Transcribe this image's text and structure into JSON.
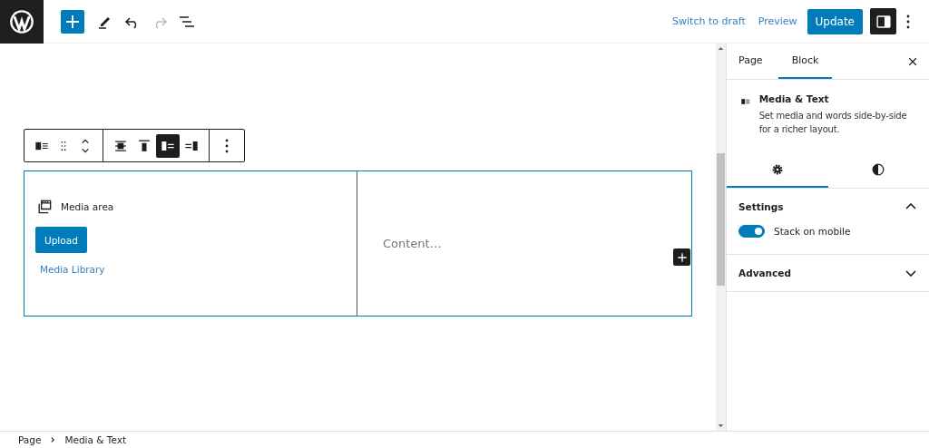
{
  "top_bar": {
    "tools": [
      {
        "kind": "inserter",
        "disabled": false
      },
      {
        "kind": "tools",
        "disabled": false
      },
      {
        "kind": "undo",
        "disabled": false
      },
      {
        "kind": "redo",
        "disabled": true
      },
      {
        "kind": "outline",
        "disabled": false
      }
    ],
    "links": [
      "Switch to draft",
      "Preview"
    ],
    "primary_button": "Update",
    "settings_toggle": {
      "selected": true
    }
  },
  "block_toolbar": {
    "block_tools": [
      {
        "kind": "block-type"
      },
      {
        "kind": "drag"
      },
      {
        "kind": "mover"
      }
    ],
    "alignment": [
      {
        "kind": "align-center",
        "selected": false
      },
      {
        "kind": "align-top",
        "selected": false
      },
      {
        "kind": "media-left",
        "selected": true
      },
      {
        "kind": "media-right",
        "selected": false
      }
    ]
  },
  "media_text": {
    "media_label": "Media area",
    "upload_button": "Upload",
    "library_link": "Media Library",
    "content_placeholder": "Content…"
  },
  "sidebar": {
    "tabs": [
      {
        "label": "Page",
        "selected": false
      },
      {
        "label": "Block",
        "selected": true
      }
    ],
    "block_card": {
      "title": "Media & Text",
      "description": "Set media and words side-by-side for a richer layout."
    },
    "inspector_tabs": [
      {
        "kind": "settings",
        "selected": true
      },
      {
        "kind": "styles",
        "selected": false
      }
    ],
    "panels": [
      {
        "title": "Settings",
        "expanded": true,
        "controls": [
          {
            "kind": "toggle",
            "label": "Stack on mobile",
            "on": true
          }
        ]
      },
      {
        "title": "Advanced",
        "expanded": false
      }
    ]
  },
  "breadcrumb": [
    "Page",
    "Media & Text"
  ]
}
